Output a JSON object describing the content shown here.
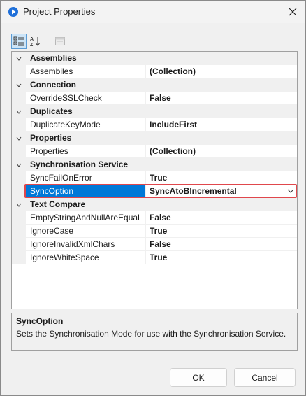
{
  "window": {
    "title": "Project Properties"
  },
  "toolbar": {
    "buttons": [
      "categorized-icon",
      "alphabetical-icon",
      "property-pages-icon"
    ]
  },
  "grid": {
    "categories": [
      {
        "label": "Assemblies",
        "properties": [
          {
            "name": "Assembiles",
            "value": "(Collection)"
          }
        ]
      },
      {
        "label": "Connection",
        "properties": [
          {
            "name": "OverrideSSLCheck",
            "value": "False"
          }
        ]
      },
      {
        "label": "Duplicates",
        "properties": [
          {
            "name": "DuplicateKeyMode",
            "value": "IncludeFirst"
          }
        ]
      },
      {
        "label": "Properties",
        "properties": [
          {
            "name": "Properties",
            "value": "(Collection)"
          }
        ]
      },
      {
        "label": "Synchronisation Service",
        "properties": [
          {
            "name": "SyncFailOnError",
            "value": "True"
          },
          {
            "name": "SyncOption",
            "value": "SyncAtoBIncremental",
            "selected": true
          }
        ]
      },
      {
        "label": "Text Compare",
        "properties": [
          {
            "name": "EmptyStringAndNullAreEqual",
            "value": "False"
          },
          {
            "name": "IgnoreCase",
            "value": "True"
          },
          {
            "name": "IgnoreInvalidXmlChars",
            "value": "False"
          },
          {
            "name": "IgnoreWhiteSpace",
            "value": "True"
          }
        ]
      }
    ]
  },
  "description": {
    "title": "SyncOption",
    "text": "Sets the Synchronisation Mode for use with the Synchronisation Service."
  },
  "buttons": {
    "ok": "OK",
    "cancel": "Cancel"
  },
  "colors": {
    "selection": "#0078d7",
    "highlight": "#e0474c"
  }
}
